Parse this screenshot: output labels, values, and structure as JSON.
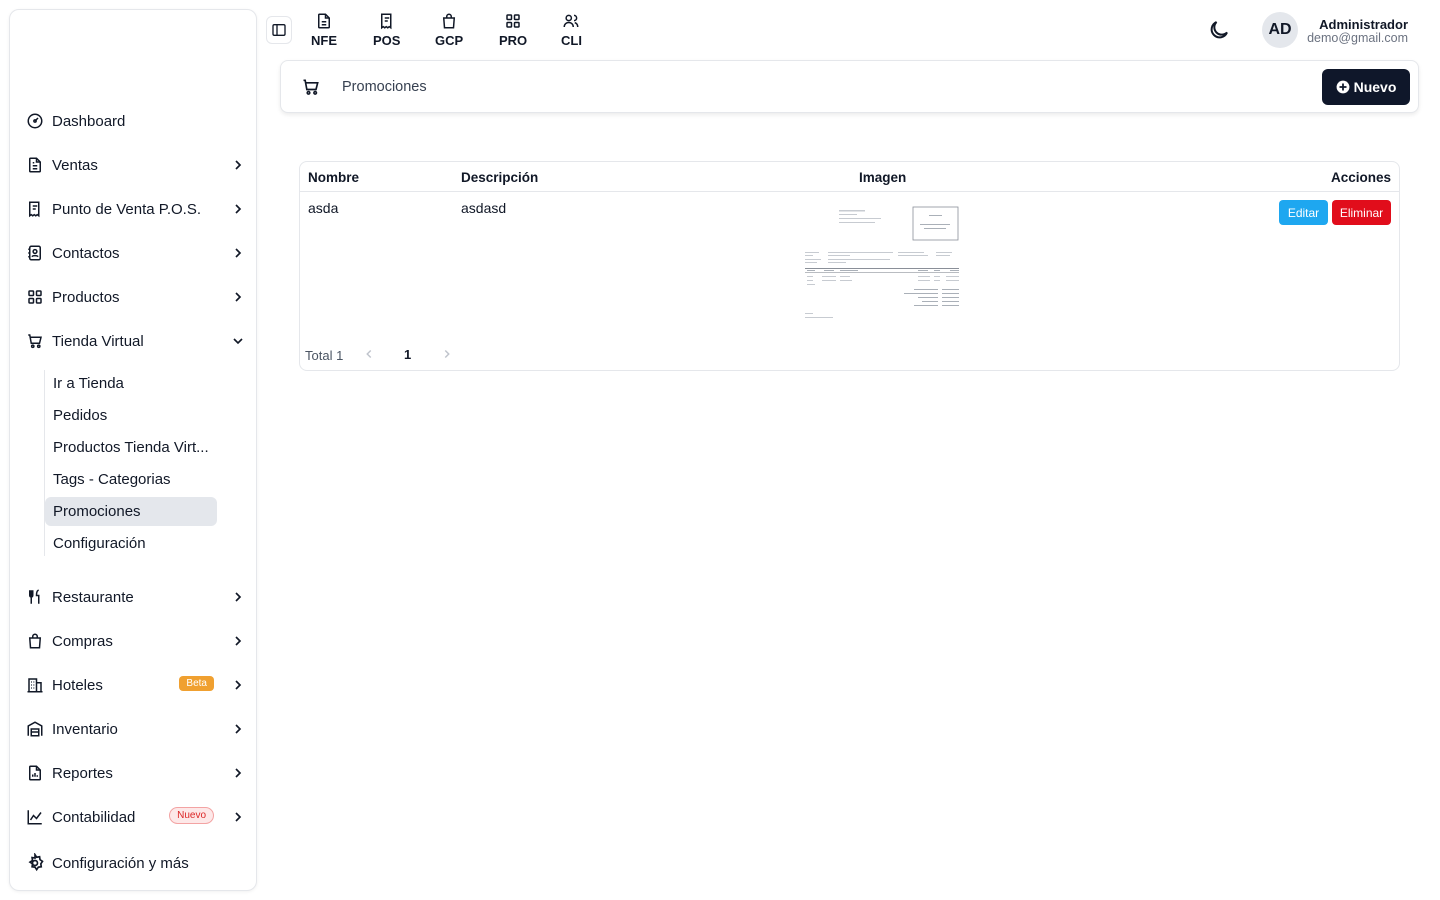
{
  "topbar": {
    "quick_links": [
      {
        "label": "NFE",
        "icon": "file-text-icon"
      },
      {
        "label": "POS",
        "icon": "receipt-icon"
      },
      {
        "label": "GCP",
        "icon": "shopping-bag-icon"
      },
      {
        "label": "PRO",
        "icon": "grid-icon"
      },
      {
        "label": "CLI",
        "icon": "users-icon"
      }
    ],
    "user": {
      "initials": "AD",
      "name": "Administrador",
      "email": "demo@gmail.com"
    }
  },
  "sidebar": {
    "items": [
      {
        "label": "Dashboard",
        "icon": "gauge-icon"
      },
      {
        "label": "Ventas",
        "icon": "file-text-icon"
      },
      {
        "label": "Punto de Venta P.O.S.",
        "icon": "receipt-icon"
      },
      {
        "label": "Contactos",
        "icon": "contact-book-icon"
      },
      {
        "label": "Productos",
        "icon": "grid-icon"
      },
      {
        "label": "Tienda Virtual",
        "icon": "cart-icon",
        "expanded": true
      },
      {
        "label": "Restaurante",
        "icon": "utensils-icon"
      },
      {
        "label": "Compras",
        "icon": "shopping-bag-icon"
      },
      {
        "label": "Hoteles",
        "icon": "building-icon",
        "badge": "Beta"
      },
      {
        "label": "Inventario",
        "icon": "warehouse-icon"
      },
      {
        "label": "Reportes",
        "icon": "report-icon"
      },
      {
        "label": "Contabilidad",
        "icon": "chart-line-icon",
        "badge": "Nuevo"
      },
      {
        "label": "Configuración y más",
        "icon": "gear-icon"
      }
    ],
    "tienda_sub": [
      {
        "label": "Ir a Tienda"
      },
      {
        "label": "Pedidos"
      },
      {
        "label": "Productos Tienda Virt..."
      },
      {
        "label": "Tags - Categorias"
      },
      {
        "label": "Promociones",
        "active": true
      },
      {
        "label": "Configuración"
      }
    ]
  },
  "header": {
    "title": "Promociones",
    "new_button": "Nuevo"
  },
  "table": {
    "columns": [
      "Nombre",
      "Descripción",
      "Imagen",
      "Acciones"
    ],
    "rows": [
      {
        "nombre": "asda",
        "descripcion": "asdasd",
        "edit": "Editar",
        "delete": "Eliminar"
      }
    ],
    "total_text": "Total 1",
    "page": "1"
  },
  "colors": {
    "primary_dark": "#0f172a",
    "edit_blue": "#1ea7f0",
    "delete_red": "#e10d1b",
    "beta_orange": "#f0a030"
  }
}
